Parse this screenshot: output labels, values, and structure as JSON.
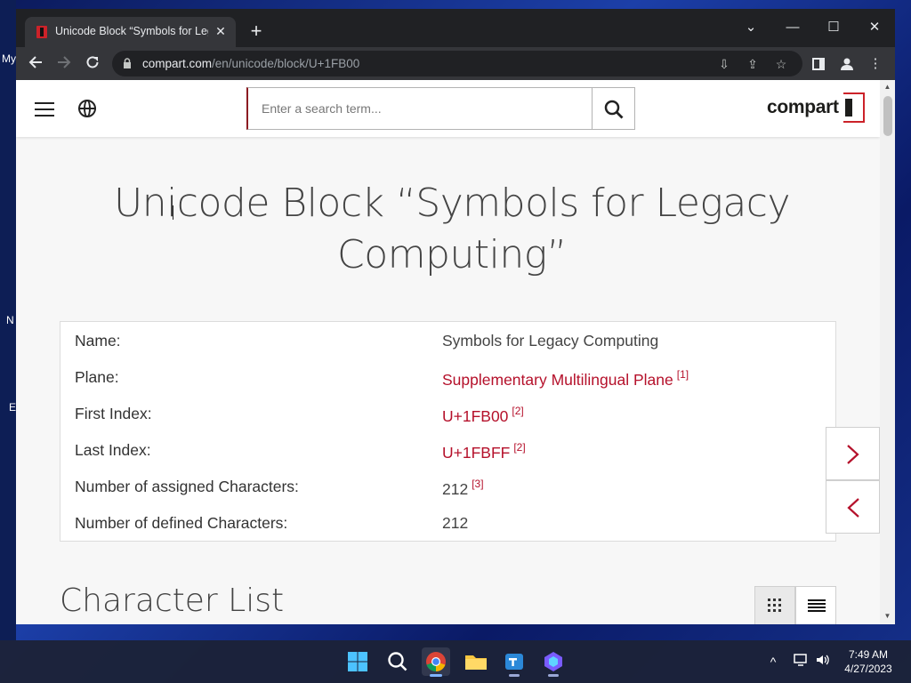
{
  "desktop": {
    "labels": [
      "My",
      "N",
      "E"
    ]
  },
  "browser": {
    "tab": {
      "title": "Unicode Block “Symbols for Legacy Computing”",
      "close_glyph": "✕"
    },
    "new_tab_glyph": "+",
    "window_controls": {
      "menu": "⌄",
      "minimize": "—",
      "maximize": "☐",
      "close": "✕"
    },
    "url": {
      "domain": "compart.com",
      "path": "/en/unicode/block/U+1FB00"
    }
  },
  "site": {
    "search": {
      "placeholder": "Enter a search term..."
    },
    "logo": {
      "text": "compart"
    },
    "page_title": "Unicode Block “Symbols for Legacy Computing”",
    "info": {
      "rows": [
        {
          "key": "Name:",
          "value": "Symbols for Legacy Computing",
          "ref": "",
          "link": false
        },
        {
          "key": "Plane:",
          "value": "Supplementary Multilingual Plane",
          "ref": "[1]",
          "link": true
        },
        {
          "key": "First Index:",
          "value": "U+1FB00",
          "ref": "[2]",
          "link": true
        },
        {
          "key": "Last Index:",
          "value": "U+1FBFF",
          "ref": "[2]",
          "link": true
        },
        {
          "key": "Number of assigned Characters:",
          "value": "212",
          "ref": "[3]",
          "link": false
        },
        {
          "key": "Number of defined Characters:",
          "value": "212",
          "ref": "",
          "link": false
        }
      ]
    },
    "section_title": "Character List",
    "colors": {
      "accent": "#b5112b",
      "brand_red": "#cc2229",
      "title_gray": "#444444"
    }
  },
  "taskbar": {
    "apps": [
      "start-icon",
      "search-icon",
      "chrome-icon",
      "file-explorer-icon",
      "teams-icon",
      "copilot-icon"
    ],
    "clock": {
      "time": "7:49 AM",
      "date": "4/27/2023"
    }
  }
}
